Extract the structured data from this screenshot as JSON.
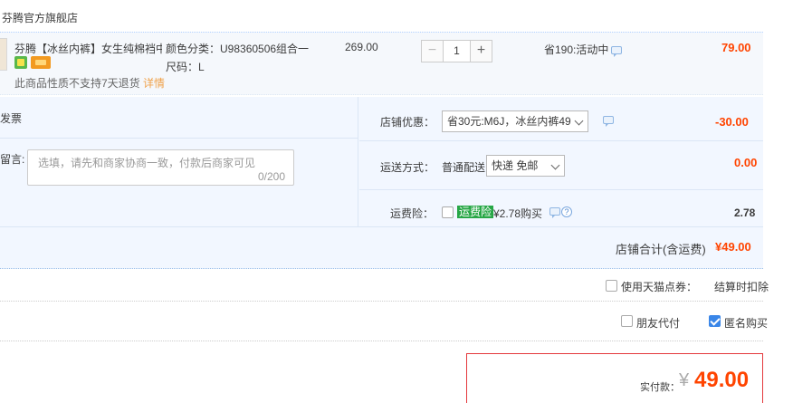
{
  "shop": {
    "name": "芬腾官方旗舰店"
  },
  "item": {
    "title": "芬腾【冰丝内裤】女生纯棉裆中...",
    "sku_color": "颜色分类：U98360506组合一",
    "sku_size": "尺码：L",
    "return_notice": "此商品性质不支持7天退货",
    "detail_link": "详情",
    "price": "269.00",
    "quantity": "1",
    "minus": "−",
    "plus": "+",
    "promotion": "省190:活动中",
    "subtotal": "79.00"
  },
  "options": {
    "invoice_label": "发票",
    "message_label": "留言:",
    "message_placeholder": "选填，请先和商家协商一致，付款后商家可见",
    "message_count": "0/200",
    "shop_coupon_label": "店铺优惠：",
    "shop_coupon_value": "省30元:M6J，冰丝内裤49",
    "shop_coupon_amount": "-30.00",
    "shipping_label": "运送方式：",
    "shipping_type": "普通配送",
    "shipping_value": "快递 免邮",
    "shipping_amount": "0.00",
    "insurance_label": "运费险：",
    "insurance_tag": "运费险",
    "insurance_text": "¥2.78购买",
    "insurance_amount": "2.78",
    "insurance_checked": false
  },
  "shop_total": {
    "label": "店铺合计(含运费)",
    "value": "¥49.00"
  },
  "tmall_points": {
    "label": "使用天猫点券：",
    "deduct": "结算时扣除",
    "checked": false
  },
  "pay_options": {
    "friend_pay": "朋友代付",
    "friend_checked": false,
    "anonymous": "匿名购买",
    "anonymous_checked": true
  },
  "payment": {
    "label": "实付款：",
    "currency": "¥",
    "amount": "49.00"
  },
  "colors": {
    "accent_red": "#ff4400",
    "accent_blue": "#3a86e8",
    "insurance_green": "#27a746"
  }
}
